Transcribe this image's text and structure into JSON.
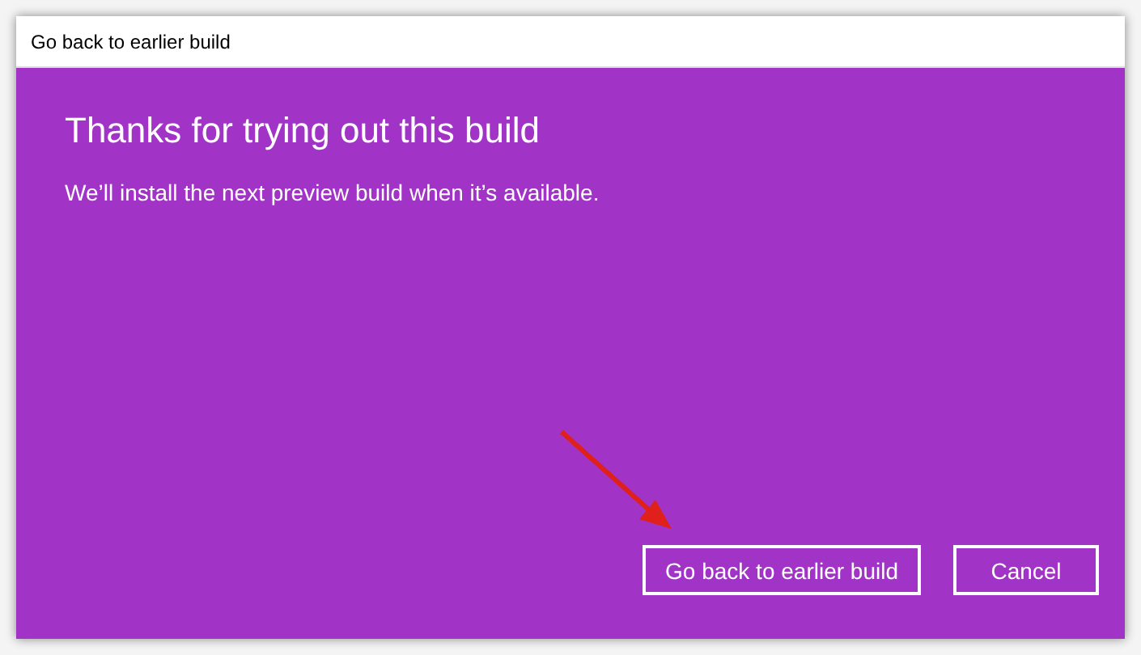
{
  "window": {
    "title": "Go back to earlier build"
  },
  "heading": "Thanks for trying out this build",
  "message": "We’ll install the next preview build when it’s available.",
  "buttons": [
    {
      "label": "Go back to earlier build"
    },
    {
      "label": "Cancel"
    }
  ]
}
